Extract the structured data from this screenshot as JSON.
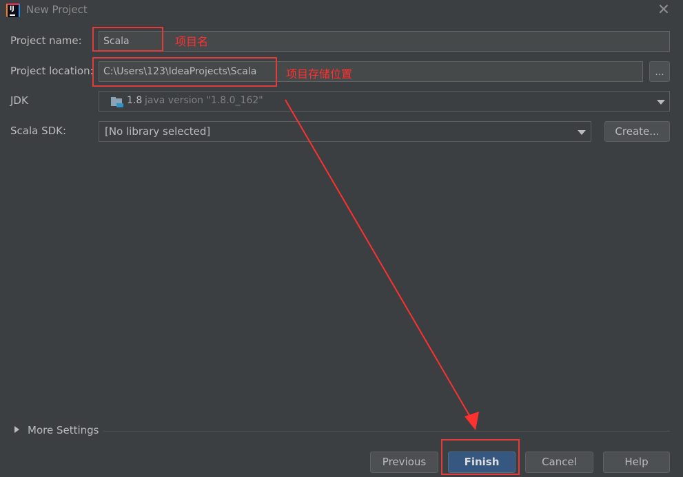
{
  "window": {
    "title": "New Project",
    "app_icon_text": "IJ"
  },
  "form": {
    "project_name": {
      "label": "Project name:",
      "value": "Scala"
    },
    "project_location": {
      "label": "Project location:",
      "value": "C:\\Users\\123\\IdeaProjects\\Scala",
      "browse_label": "..."
    },
    "jdk": {
      "label": "JDK",
      "version": "1.8",
      "detail": "java version \"1.8.0_162\""
    },
    "scala_sdk": {
      "label": "Scala SDK:",
      "value": "[No library selected]",
      "create_label": "Create..."
    }
  },
  "annotations": {
    "name_note": "项目名",
    "location_note": "项目存储位置",
    "color": "#ff3030"
  },
  "more_settings": {
    "label": "More Settings"
  },
  "footer": {
    "previous_label": "Previous",
    "finish_label": "Finish",
    "cancel_label": "Cancel",
    "help_label": "Help"
  }
}
